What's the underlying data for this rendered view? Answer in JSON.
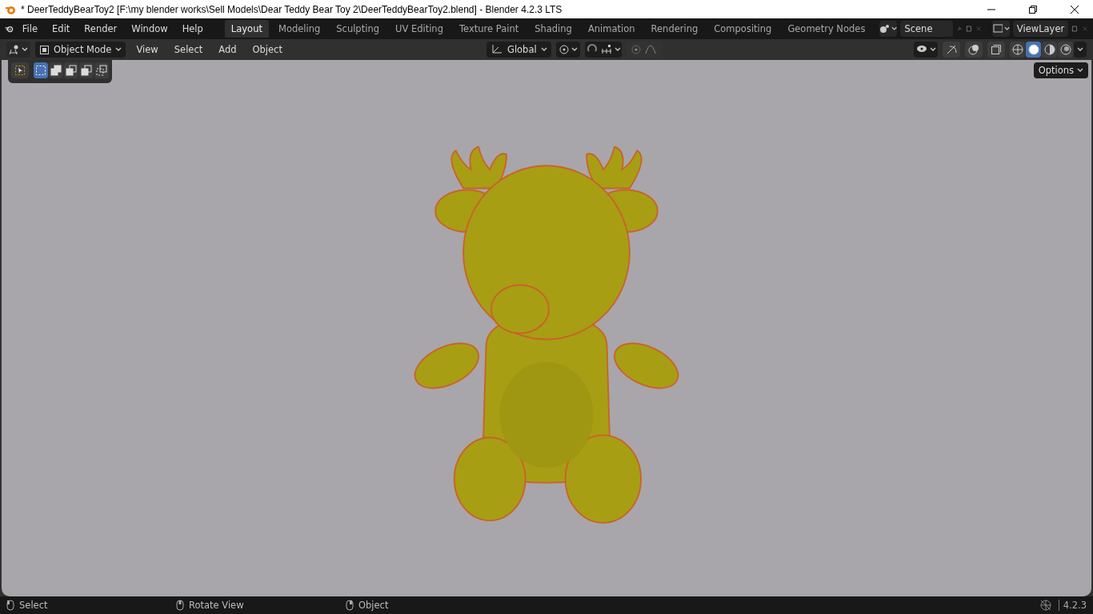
{
  "window": {
    "title": "* DeerTeddyBearToy2 [F:\\my blender works\\Sell Models\\Dear Teddy Bear Toy 2\\DeerTeddyBearToy2.blend] - Blender 4.2.3 LTS"
  },
  "menu": [
    "File",
    "Edit",
    "Render",
    "Window",
    "Help"
  ],
  "workspaces": [
    {
      "label": "Layout",
      "selected": true
    },
    {
      "label": "Modeling",
      "selected": false
    },
    {
      "label": "Sculpting",
      "selected": false
    },
    {
      "label": "UV Editing",
      "selected": false
    },
    {
      "label": "Texture Paint",
      "selected": false
    },
    {
      "label": "Shading",
      "selected": false
    },
    {
      "label": "Animation",
      "selected": false
    },
    {
      "label": "Rendering",
      "selected": false
    },
    {
      "label": "Compositing",
      "selected": false
    },
    {
      "label": "Geometry Nodes",
      "selected": false
    }
  ],
  "scene": "Scene",
  "view_layer": "ViewLayer",
  "header": {
    "mode": "Object Mode",
    "menus": [
      "View",
      "Select",
      "Add",
      "Object"
    ],
    "orientation": "Global",
    "snap": {
      "on": false
    },
    "proportional_edit": {
      "on": false
    }
  },
  "select_modes": [
    {
      "selected": true
    },
    {
      "selected": false
    },
    {
      "selected": false
    },
    {
      "selected": false
    },
    {
      "selected": false
    }
  ],
  "shading_modes": [
    {
      "selected": false
    },
    {
      "selected": true
    },
    {
      "selected": false
    },
    {
      "selected": false
    }
  ],
  "options": "Options",
  "status_bar": {
    "items": [
      "Select",
      "Rotate View",
      "Object"
    ],
    "version": "4.2.3"
  }
}
